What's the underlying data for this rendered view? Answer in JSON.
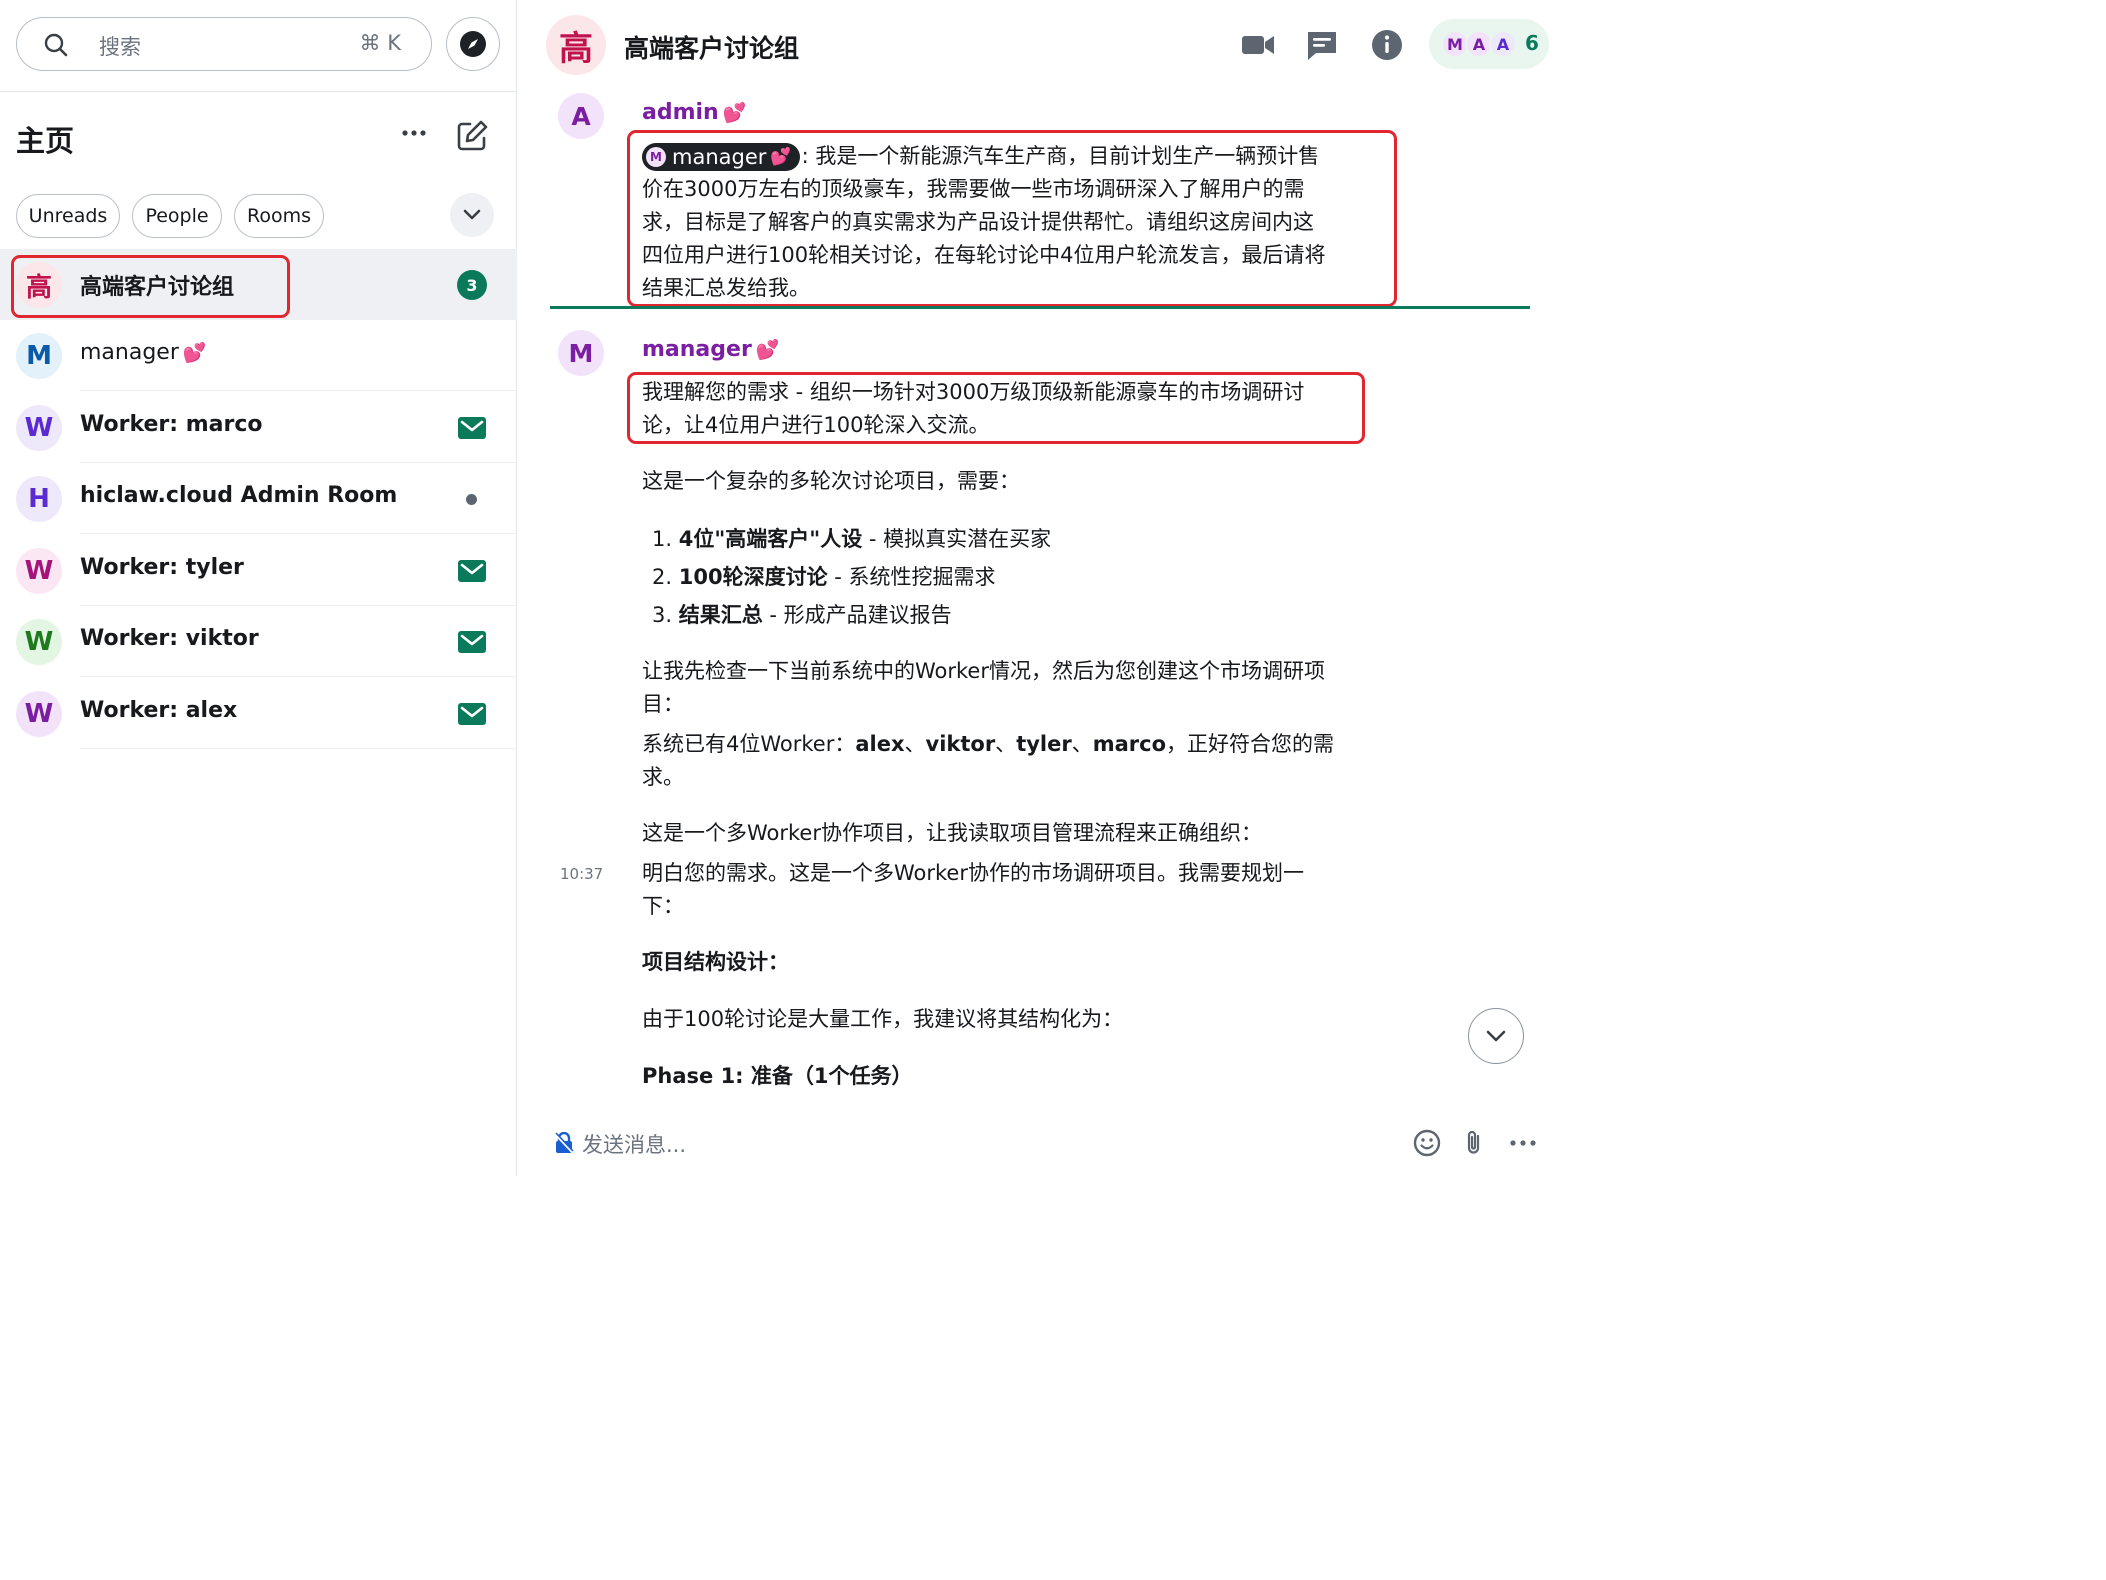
{
  "search": {
    "placeholder": "搜索",
    "shortcut": "⌘ K"
  },
  "home": {
    "title": "主页"
  },
  "filters": [
    "Unreads",
    "People",
    "Rooms"
  ],
  "rooms": [
    {
      "avatar": "高",
      "name": "高端客户讨论组",
      "unread": "3"
    },
    {
      "avatar": "M",
      "name": "manager"
    },
    {
      "avatar": "W",
      "name": "Worker: marco"
    },
    {
      "avatar": "H",
      "name": "hiclaw.cloud Admin Room"
    },
    {
      "avatar": "W",
      "name": "Worker: tyler"
    },
    {
      "avatar": "W",
      "name": "Worker: viktor"
    },
    {
      "avatar": "W",
      "name": "Worker: alex"
    }
  ],
  "header": {
    "avatar": "高",
    "title": "高端客户讨论组",
    "member_faces": [
      "M",
      "A",
      "A"
    ],
    "member_count": "6"
  },
  "messages": {
    "admin": {
      "avatar": "A",
      "sender": "admin",
      "mention_avatar": "M",
      "mention": "manager",
      "text_after_mention": ": 我是一个新能源汽车生产商，目前计划生产一辆预计售",
      "lines": [
        "价在3000万左右的顶级豪车，我需要做一些市场调研深入了解用户的需",
        "求，目标是了解客户的真实需求为产品设计提供帮忙。请组织这房间内这",
        "四位用户进行100轮相关讨论，在每轮讨论中4位用户轮流发言，最后请将",
        "结果汇总发给我。"
      ]
    },
    "manager": {
      "avatar": "M",
      "sender": "manager",
      "intro_lines": [
        "我理解您的需求 - 组织一场针对3000万级顶级新能源豪车的市场调研讨",
        "论，让4位用户进行100轮深入交流。"
      ],
      "complex": "这是一个复杂的多轮次讨论项目，需要：",
      "list": [
        {
          "num": "1.",
          "bold": "4位\"高端客户\"人设",
          "rest": " - 模拟真实潜在买家"
        },
        {
          "num": "2.",
          "bold": "100轮深度讨论",
          "rest": " - 系统性挖掘需求"
        },
        {
          "num": "3.",
          "bold": "结果汇总",
          "rest": " - 形成产品建议报告"
        }
      ],
      "check_lines": [
        "让我先检查一下当前系统中的Worker情况，然后为您创建这个市场调研项",
        "目："
      ],
      "workers_prefix": "系统已有4位Worker：",
      "workers": [
        "alex",
        "viktor",
        "tyler",
        "marco"
      ],
      "workers_sep": "、",
      "workers_suffix": "，正好符合您的需",
      "workers_suffix2": "求。",
      "multi": "这是一个多Worker协作项目，让我读取项目管理流程来正确组织：",
      "timestamp": "10:37",
      "understand_lines": [
        "明白您的需求。这是一个多Worker协作的市场调研项目。我需要规划一",
        "下："
      ],
      "design_title": "项目结构设计：",
      "suggest": "由于100轮讨论是大量工作，我建议将其结构化为：",
      "phase": "Phase 1: 准备（1个任务）"
    }
  },
  "composer": {
    "placeholder": "发送消息..."
  },
  "colors": {
    "accent_green": "#0b7a5a",
    "highlight_red": "#e02730",
    "sender_purple": "#7b1fa2",
    "selected_bg": "#eef0f3"
  }
}
